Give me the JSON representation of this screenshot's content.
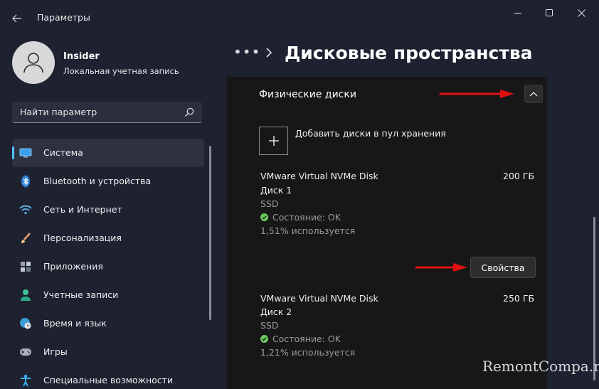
{
  "window": {
    "title": "Параметры",
    "controls": {
      "minimize": "minimize-icon",
      "maximize": "maximize-icon",
      "close": "close-icon"
    }
  },
  "profile": {
    "name": "Insider",
    "account_type": "Локальная учетная запись"
  },
  "search": {
    "placeholder": "Найти параметр"
  },
  "sidebar": {
    "items": [
      {
        "label": "Система",
        "icon": "monitor-icon",
        "active": true
      },
      {
        "label": "Bluetooth и устройства",
        "icon": "bluetooth-icon"
      },
      {
        "label": "Сеть и Интернет",
        "icon": "wifi-icon"
      },
      {
        "label": "Персонализация",
        "icon": "brush-icon"
      },
      {
        "label": "Приложения",
        "icon": "apps-icon"
      },
      {
        "label": "Учетные записи",
        "icon": "person-icon"
      },
      {
        "label": "Время и язык",
        "icon": "globe-clock-icon"
      },
      {
        "label": "Игры",
        "icon": "gamepad-icon"
      },
      {
        "label": "Специальные возможности",
        "icon": "accessibility-icon"
      }
    ]
  },
  "header": {
    "breadcrumb_more": "•••",
    "title": "Дисковые пространства"
  },
  "main": {
    "section_title": "Физические диски",
    "add_disks_label": "Добавить диски в пул хранения",
    "disks": [
      {
        "name": "VMware Virtual NVMe Disk",
        "number": "Диск 1",
        "type": "SSD",
        "status": "Состояние: OK",
        "usage": "1,51% используется",
        "size": "200 ГБ"
      },
      {
        "name": "VMware Virtual NVMe Disk",
        "number": "Диск 2",
        "type": "SSD",
        "status": "Состояние: OK",
        "usage": "1,21% используется",
        "size": "250 ГБ"
      }
    ],
    "properties_button": "Свойства"
  },
  "watermark": "RemontCompa.ru",
  "colors": {
    "accent": "#4cc2ff",
    "status_ok": "#6ccb5f",
    "annotation_arrow": "#e01010"
  }
}
